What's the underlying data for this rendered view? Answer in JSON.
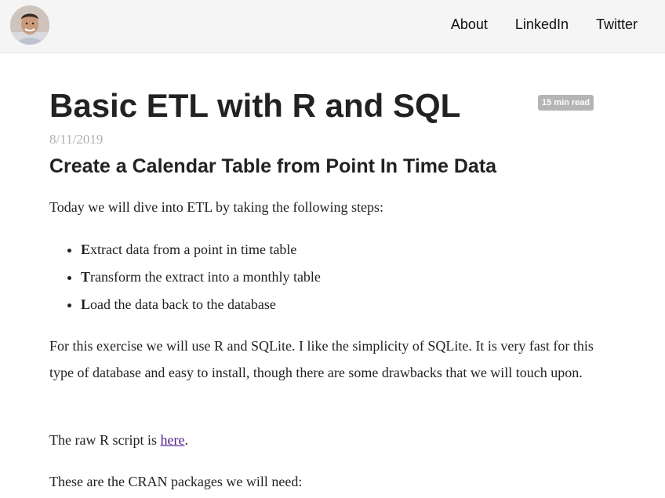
{
  "header": {
    "avatar_alt": "Author photo",
    "nav": {
      "about": "About",
      "linkedin": "LinkedIn",
      "twitter": "Twitter"
    }
  },
  "post": {
    "title": "Basic ETL with R and SQL",
    "read_time": "15 min read",
    "date": "8/11/2019",
    "subtitle": "Create a Calendar Table from Point In Time Data",
    "intro": "Today we will dive into ETL by taking the following steps:",
    "steps": [
      {
        "first": "E",
        "rest": "xtract data from a point in time table"
      },
      {
        "first": "T",
        "rest": "ransform the extract into a monthly table"
      },
      {
        "first": "L",
        "rest": "oad the data back to the database"
      }
    ],
    "exercise_paragraph": "For this exercise we will use R and SQLite. I like the simplicity of SQLite. It is very fast for this type of database and easy to install, though there are some drawbacks that we will touch upon.",
    "script_prefix": "The raw R script is ",
    "script_link": "here",
    "script_suffix": ".",
    "cran_paragraph": "These are the CRAN packages we will need:"
  },
  "colors": {
    "header_bg": "#f5f5f5",
    "badge_bg": "#b5b5b5",
    "date_text": "#b0b0b0",
    "link": "#551a8b"
  }
}
